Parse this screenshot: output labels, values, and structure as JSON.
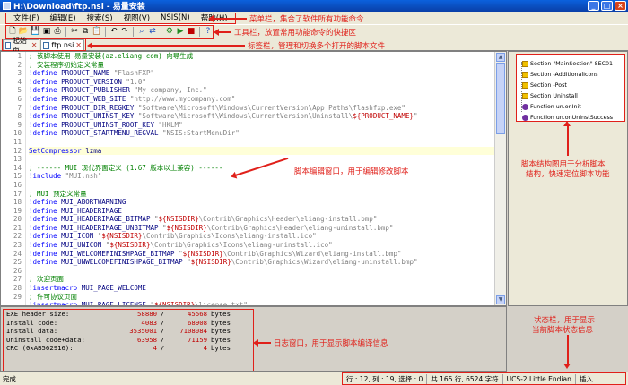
{
  "window": {
    "title": "H:\\Download\\ftp.nsi - 易量安装"
  },
  "menu": [
    "文件(F)",
    "编辑(E)",
    "搜索(S)",
    "视图(V)",
    "NSIS(N)",
    "帮助(H)"
  ],
  "toolbar_icons": [
    "new-icon",
    "open-icon",
    "save-icon",
    "save-all-icon",
    "print-icon",
    "cut-icon",
    "copy-icon",
    "paste-icon",
    "undo-icon",
    "redo-icon",
    "find-icon",
    "replace-icon",
    "compile-icon",
    "run-icon",
    "stop-icon",
    "help-icon"
  ],
  "tabs": [
    {
      "label": "起始页"
    },
    {
      "label": "ftp.nsi"
    }
  ],
  "annotations": {
    "menu": "菜单栏，集合了软件所有功能命令",
    "toolbar": "工具栏，放置常用功能命令的快捷区",
    "tabs": "标签栏，管理和切换多个打开的脚本文件",
    "editor": "脚本编辑窗口，用于编辑修改脚本",
    "structure_1": "脚本结构图用于分析脚本",
    "structure_2": "结构，快速定位脚本功能",
    "log": "日志窗口，用于显示脚本编译信息",
    "status_1": "状态栏，用于显示",
    "status_2": "当前脚本状态信息"
  },
  "editor": {
    "line_numbers": [
      "1",
      "2",
      "3",
      "4",
      "5",
      "6",
      "7",
      "8",
      "9",
      "10",
      "11",
      "12",
      "13",
      "14",
      "15",
      "16",
      "17",
      "18",
      "19",
      "20",
      "21",
      "22",
      "23",
      "24",
      "25",
      "26",
      "27",
      "28",
      "29"
    ],
    "current_line": 12,
    "lines": [
      [
        {
          "t": "; 该脚本使用 易量安装(az.eliang.com) 向导生成",
          "c": "comment"
        }
      ],
      [
        {
          "t": "; 安装程序初始定义常量",
          "c": "comment"
        }
      ],
      [
        {
          "t": "!define",
          "c": "kw"
        },
        {
          "t": " PRODUCT_NAME ",
          "c": "plain"
        },
        {
          "t": "\"FlashFXP\"",
          "c": "str"
        }
      ],
      [
        {
          "t": "!define",
          "c": "kw"
        },
        {
          "t": " PRODUCT_VERSION ",
          "c": "plain"
        },
        {
          "t": "\"1.0\"",
          "c": "str"
        }
      ],
      [
        {
          "t": "!define",
          "c": "kw"
        },
        {
          "t": " PRODUCT_PUBLISHER ",
          "c": "plain"
        },
        {
          "t": "\"My company, Inc.\"",
          "c": "str"
        }
      ],
      [
        {
          "t": "!define",
          "c": "kw"
        },
        {
          "t": " PRODUCT_WEB_SITE ",
          "c": "plain"
        },
        {
          "t": "\"http://www.mycompany.com\"",
          "c": "str"
        }
      ],
      [
        {
          "t": "!define",
          "c": "kw"
        },
        {
          "t": " PRODUCT_DIR_REGKEY ",
          "c": "plain"
        },
        {
          "t": "\"Software\\Microsoft\\Windows\\CurrentVersion\\App Paths\\flashfxp.exe\"",
          "c": "str"
        }
      ],
      [
        {
          "t": "!define",
          "c": "kw"
        },
        {
          "t": " PRODUCT_UNINST_KEY ",
          "c": "plain"
        },
        {
          "t": "\"Software\\Microsoft\\Windows\\CurrentVersion\\Uninstall\\",
          "c": "str"
        },
        {
          "t": "${PRODUCT_NAME}",
          "c": "var"
        },
        {
          "t": "\"",
          "c": "str"
        }
      ],
      [
        {
          "t": "!define",
          "c": "kw"
        },
        {
          "t": " PRODUCT_UNINST_ROOT_KEY ",
          "c": "plain"
        },
        {
          "t": "\"HKLM\"",
          "c": "str"
        }
      ],
      [
        {
          "t": "!define",
          "c": "kw"
        },
        {
          "t": " PRODUCT_STARTMENU_REGVAL ",
          "c": "plain"
        },
        {
          "t": "\"NSIS:StartMenuDir\"",
          "c": "str"
        }
      ],
      [
        {
          "t": "",
          "c": "plain"
        }
      ],
      [
        {
          "t": "SetCompressor ",
          "c": "kw"
        },
        {
          "t": "lzma",
          "c": "plain"
        }
      ],
      [
        {
          "t": "",
          "c": "plain"
        }
      ],
      [
        {
          "t": "; ------ MUI 现代界面定义 (1.67 版本以上兼容) ------",
          "c": "comment"
        }
      ],
      [
        {
          "t": "!include",
          "c": "kw"
        },
        {
          "t": " ",
          "c": "plain"
        },
        {
          "t": "\"MUI.nsh\"",
          "c": "str"
        }
      ],
      [
        {
          "t": "",
          "c": "plain"
        }
      ],
      [
        {
          "t": "; MUI 预定义常量",
          "c": "comment"
        }
      ],
      [
        {
          "t": "!define",
          "c": "kw"
        },
        {
          "t": " MUI_ABORTWARNING",
          "c": "plain"
        }
      ],
      [
        {
          "t": "!define",
          "c": "kw"
        },
        {
          "t": " MUI_HEADERIMAGE",
          "c": "plain"
        }
      ],
      [
        {
          "t": "!define",
          "c": "kw"
        },
        {
          "t": " MUI_HEADERIMAGE_BITMAP ",
          "c": "plain"
        },
        {
          "t": "\"",
          "c": "str"
        },
        {
          "t": "${NSISDIR}",
          "c": "var"
        },
        {
          "t": "\\Contrib\\Graphics\\Header\\eliang-install.bmp\"",
          "c": "str"
        }
      ],
      [
        {
          "t": "!define",
          "c": "kw"
        },
        {
          "t": " MUI_HEADERIMAGE_UNBITMAP ",
          "c": "plain"
        },
        {
          "t": "\"",
          "c": "str"
        },
        {
          "t": "${NSISDIR}",
          "c": "var"
        },
        {
          "t": "\\Contrib\\Graphics\\Header\\eliang-uninstall.bmp\"",
          "c": "str"
        }
      ],
      [
        {
          "t": "!define",
          "c": "kw"
        },
        {
          "t": " MUI_ICON ",
          "c": "plain"
        },
        {
          "t": "\"",
          "c": "str"
        },
        {
          "t": "${NSISDIR}",
          "c": "var"
        },
        {
          "t": "\\Contrib\\Graphics\\Icons\\eliang-install.ico\"",
          "c": "str"
        }
      ],
      [
        {
          "t": "!define",
          "c": "kw"
        },
        {
          "t": " MUI_UNICON ",
          "c": "plain"
        },
        {
          "t": "\"",
          "c": "str"
        },
        {
          "t": "${NSISDIR}",
          "c": "var"
        },
        {
          "t": "\\Contrib\\Graphics\\Icons\\eliang-uninstall.ico\"",
          "c": "str"
        }
      ],
      [
        {
          "t": "!define",
          "c": "kw"
        },
        {
          "t": " MUI_WELCOMEFINISHPAGE_BITMAP ",
          "c": "plain"
        },
        {
          "t": "\"",
          "c": "str"
        },
        {
          "t": "${NSISDIR}",
          "c": "var"
        },
        {
          "t": "\\Contrib\\Graphics\\Wizard\\eliang-install.bmp\"",
          "c": "str"
        }
      ],
      [
        {
          "t": "!define",
          "c": "kw"
        },
        {
          "t": " MUI_UNWELCOMEFINISHPAGE_BITMAP ",
          "c": "plain"
        },
        {
          "t": "\"",
          "c": "str"
        },
        {
          "t": "${NSISDIR}",
          "c": "var"
        },
        {
          "t": "\\Contrib\\Graphics\\Wizard\\eliang-uninstall.bmp\"",
          "c": "str"
        }
      ],
      [
        {
          "t": "",
          "c": "plain"
        }
      ],
      [
        {
          "t": "; 欢迎页面",
          "c": "comment"
        }
      ],
      [
        {
          "t": "!insertmacro",
          "c": "kw"
        },
        {
          "t": " MUI_PAGE_WELCOME",
          "c": "plain"
        }
      ],
      [
        {
          "t": "; 许可协议页面",
          "c": "comment"
        }
      ],
      [
        {
          "t": "!insertmacro",
          "c": "kw"
        },
        {
          "t": " MUI_PAGE_LICENSE ",
          "c": "plain"
        },
        {
          "t": "\"",
          "c": "str"
        },
        {
          "t": "${NSISDIR}",
          "c": "var"
        },
        {
          "t": "\\license.txt\"",
          "c": "str"
        }
      ]
    ]
  },
  "structure": [
    {
      "label": "Section \"MainSection\" SEC01",
      "kind": "section"
    },
    {
      "label": "Section -AdditionalIcons",
      "kind": "section"
    },
    {
      "label": "Section -Post",
      "kind": "section"
    },
    {
      "label": "Section Uninstall",
      "kind": "section"
    },
    {
      "label": "Function un.onInit",
      "kind": "function"
    },
    {
      "label": "Function un.onUninstSuccess",
      "kind": "function"
    }
  ],
  "log": [
    {
      "label": "EXE header size:",
      "v1": "58880",
      "v2": "45568",
      "unit": "bytes"
    },
    {
      "label": "Install code:",
      "v1": "4083",
      "v2": "68908",
      "unit": "bytes"
    },
    {
      "label": "Install data:",
      "v1": "3535001",
      "v2": "7108084",
      "unit": "bytes"
    },
    {
      "label": "Uninstall code+data:",
      "v1": "63958",
      "v2": "71159",
      "unit": "bytes"
    },
    {
      "label": "CRC (0xAB562916):",
      "v1": "4",
      "v2": "4",
      "unit": "bytes"
    }
  ],
  "status": {
    "ready": "完成",
    "position": "行 : 12, 列 : 19, 选择 : 0",
    "total": "共 165 行, 6524 字符",
    "encoding": "UCS-2 Little Endian",
    "mode": "插入"
  }
}
